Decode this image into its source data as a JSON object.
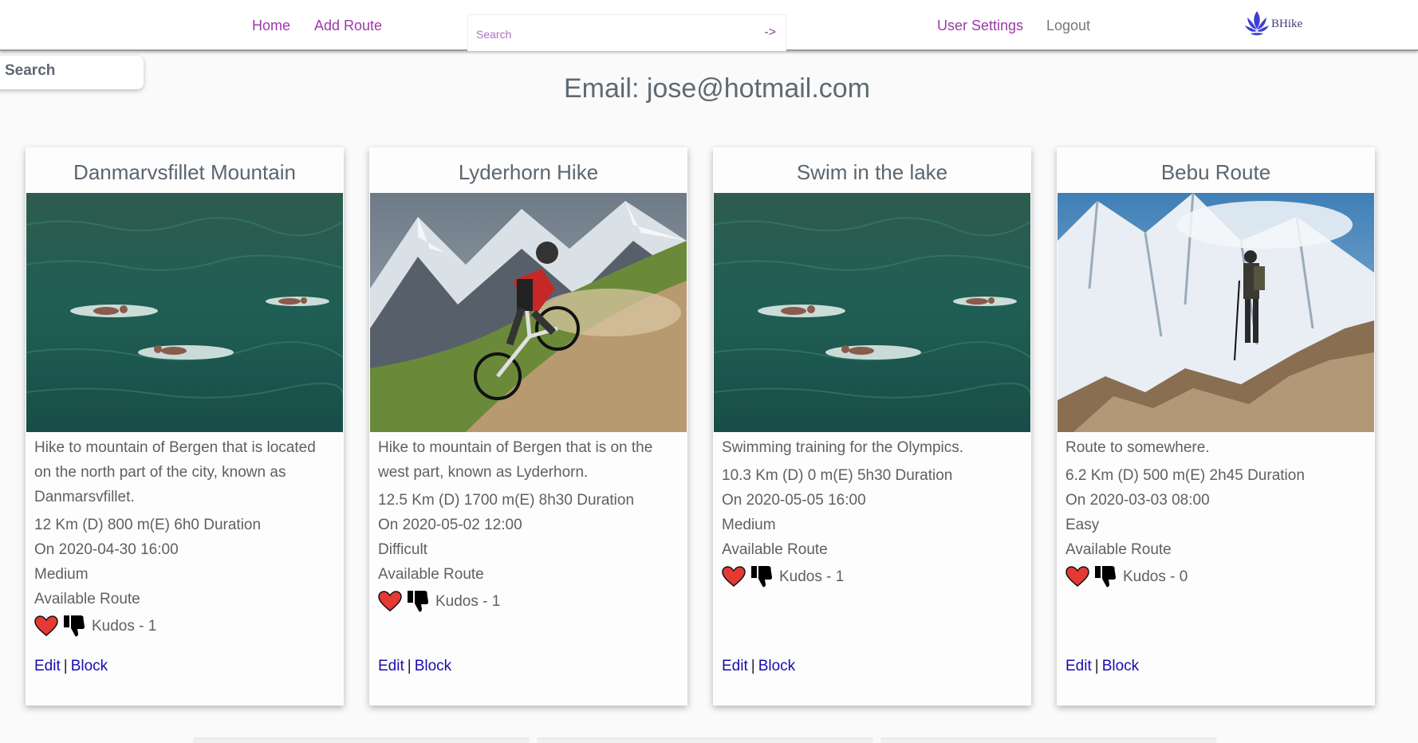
{
  "nav": {
    "home_label": "Home",
    "add_route_label": "Add Route",
    "search_placeholder": "Search",
    "search_go": "->",
    "user_settings_label": "User Settings",
    "logout_label": "Logout",
    "brand_name": "BHike",
    "brand_icon": "lotus-icon",
    "accent_color": "#9b3aa8"
  },
  "side_search": {
    "label": "Search"
  },
  "profile": {
    "email_heading": "Email: jose@hotmail.com"
  },
  "cards": [
    {
      "title": "Danmarvsfillet Mountain",
      "image": "swimmers-in-lake",
      "description": "Hike to mountain of Bergen that is located on the north part of the city, known as Danmarsvfillet.",
      "stats": "12 Km (D) 800 m(E) 6h0 Duration",
      "date": "On 2020-04-30 16:00",
      "difficulty": "Medium",
      "availability": "Available Route",
      "kudos": "Kudos - 1",
      "edit_label": "Edit",
      "separator": "|",
      "block_label": "Block"
    },
    {
      "title": "Lyderhorn Hike",
      "image": "mountain-biker",
      "description": "Hike to mountain of Bergen that is on the west part, known as Lyderhorn.",
      "stats": "12.5 Km (D) 1700 m(E) 8h30 Duration",
      "date": "On 2020-05-02 12:00",
      "difficulty": "Difficult",
      "availability": "Available Route",
      "kudos": "Kudos - 1",
      "edit_label": "Edit",
      "separator": "|",
      "block_label": "Block"
    },
    {
      "title": "Swim in the lake",
      "image": "swimmers-in-lake",
      "description": "Swimming training for the Olympics.",
      "stats": "10.3 Km (D) 0 m(E) 5h30 Duration",
      "date": "On 2020-05-05 16:00",
      "difficulty": "Medium",
      "availability": "Available Route",
      "kudos": "Kudos - 1",
      "edit_label": "Edit",
      "separator": "|",
      "block_label": "Block"
    },
    {
      "title": "Bebu Route",
      "image": "hiker-on-mountain",
      "description": "Route to somewhere.",
      "stats": "6.2 Km (D) 500 m(E) 2h45 Duration",
      "date": "On 2020-03-03 08:00",
      "difficulty": "Easy",
      "availability": "Available Route",
      "kudos": "Kudos - 0",
      "edit_label": "Edit",
      "separator": "|",
      "block_label": "Block"
    }
  ],
  "icons": {
    "like": "heart-icon",
    "dislike": "thumbs-down-icon"
  },
  "colors": {
    "heart": "#e53935",
    "link": "#1a0dab"
  }
}
